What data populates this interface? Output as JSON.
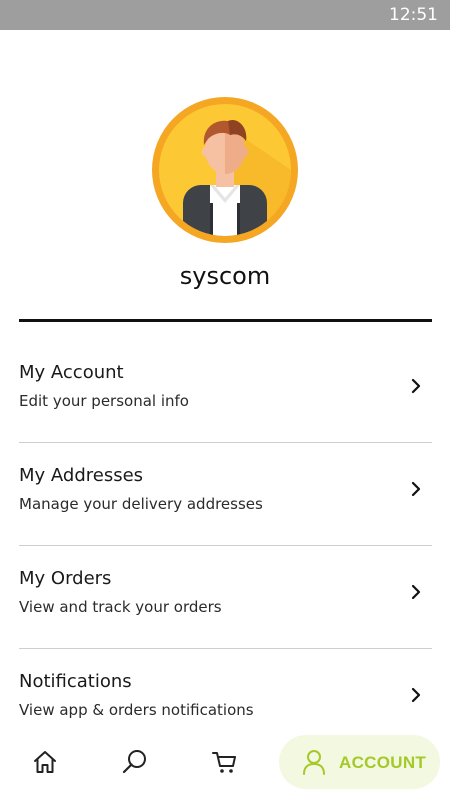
{
  "status_bar": {
    "time": "12:51"
  },
  "profile": {
    "username": "syscom",
    "avatar": "man-avatar-icon"
  },
  "menu": [
    {
      "title": "My Account",
      "subtitle": "Edit your personal info"
    },
    {
      "title": "My Addresses",
      "subtitle": "Manage your delivery addresses"
    },
    {
      "title": "My Orders",
      "subtitle": "View and track your orders"
    },
    {
      "title": "Notifications",
      "subtitle": "View app & orders notifications"
    }
  ],
  "bottom_nav": {
    "items": [
      {
        "icon": "home-icon"
      },
      {
        "icon": "search-icon"
      },
      {
        "icon": "cart-icon"
      }
    ],
    "active": {
      "icon": "user-icon",
      "label": "ACCOUNT"
    }
  },
  "colors": {
    "accent": "#a4c928",
    "accent_bg": "#f3f8e0",
    "avatar_ring": "#f5a623",
    "avatar_fill": "#fcc934",
    "status_bar": "#9e9e9e"
  }
}
